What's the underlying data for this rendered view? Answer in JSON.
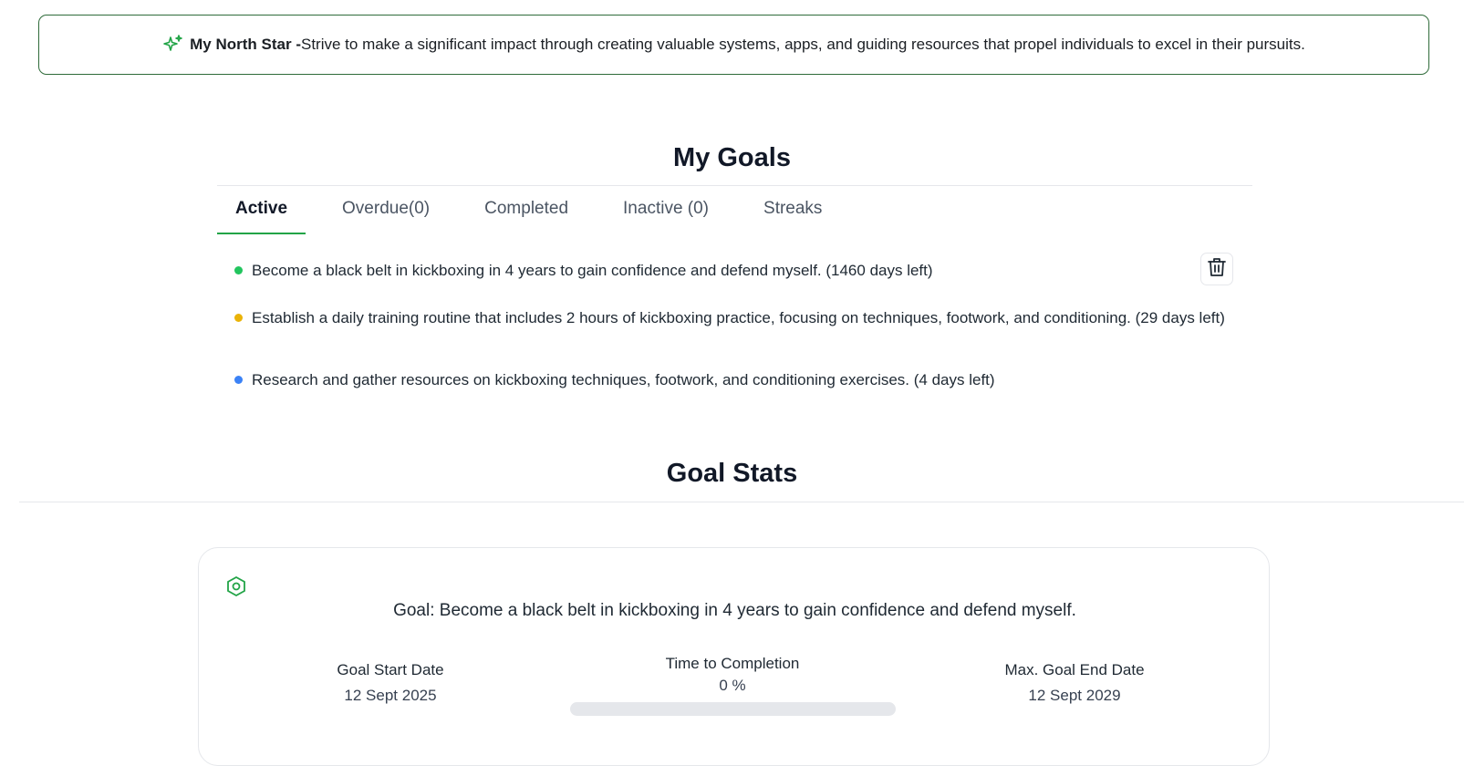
{
  "north_star": {
    "icon": "sparkles-icon",
    "label": "My North Star -",
    "text": "Strive to make a significant impact through creating valuable systems, apps, and guiding resources that propel individuals to excel in their pursuits.",
    "border_color": "#2f6b3a"
  },
  "goals": {
    "title": "My Goals",
    "tabs": [
      {
        "label": "Active",
        "active": true
      },
      {
        "label": "Overdue(0)",
        "active": false
      },
      {
        "label": "Completed",
        "active": false
      },
      {
        "label": "Inactive (0)",
        "active": false
      },
      {
        "label": "Streaks",
        "active": false
      }
    ],
    "items": [
      {
        "text": "Become a black belt in kickboxing in 4 years to gain confidence and defend myself. (1460 days left)",
        "dot_color": "#22c55e"
      },
      {
        "text": "Establish a daily training routine that includes 2 hours of kickboxing practice, focusing on techniques, footwork, and conditioning. (29 days left)",
        "dot_color": "#eab308"
      },
      {
        "text": "Research and gather resources on kickboxing techniques, footwork, and conditioning exercises. (4 days left)",
        "dot_color": "#3b82f6"
      }
    ],
    "delete_icon": "trash-icon"
  },
  "stats": {
    "title": "Goal Stats",
    "card_icon": "hexagon-target-icon",
    "goal_line": "Goal: Become a black belt in kickboxing in 4 years to gain confidence and defend myself.",
    "start_label": "Goal Start Date",
    "start_value": "12 Sept 2025",
    "completion_label": "Time to Completion",
    "completion_value": "0 %",
    "completion_fraction": 0,
    "end_label": "Max. Goal End Date",
    "end_value": "12 Sept 2029"
  },
  "colors": {
    "accent": "#22a447"
  }
}
